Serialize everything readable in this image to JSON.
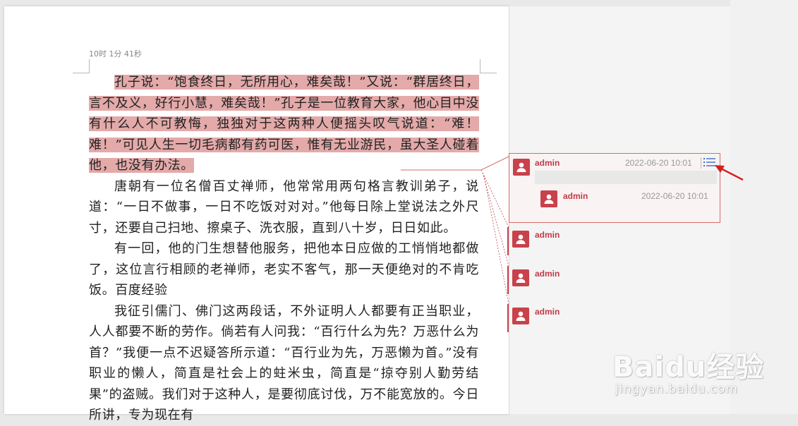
{
  "document": {
    "header_note": "10时 1分 41秒",
    "paragraphs": [
      "孔子说：“饱食终日，无所用心，难矣哉！”又说：“群居终日，言不及义，好行小慧，难矣哉！”孔子是一位教育大家，他心目中没有什么人不可教悔，独独对于这两种人便摇头叹气说道：“难！难！”可见人生一切毛病都有药可医，惟有无业游民，虽大圣人碰着他，也没有办法。",
      "唐朝有一位名僧百丈禅师，他常常用两句格言教训弟子，说道：“一日不做事，一日不吃饭对对对。”他每日除上堂说法之外尺寸，还要自己扫地、擦桌子、洗衣服，直到八十岁，日日如此。",
      "有一回，他的门生想替他服务，把他本日应做的工悄悄地都做了，这位言行相顾的老禅师，老实不客气，那一天便绝对的不肯吃饭。百度经验",
      "我征引儒门、佛门这两段话，不外证明人人都要有正当职业，人人都要不断的劳作。倘若有人问我：“百行什么为先？万恶什么为首？”我便一点不迟疑答所示道：“百行业为先，万恶懒为首。”没有职业的懒人，简直是社会上的蛀米虫，简直是“掠夺别人勤劳结果”的盗贼。我们对于这种人，是要彻底讨伐，万不能宽放的。今日所讲，专为现在有"
    ]
  },
  "comments": {
    "active": {
      "author": "admin",
      "time": "2022-06-20 10:01",
      "menu_icon": "list-menu-icon",
      "reply": {
        "author": "admin",
        "time": "2022-06-20 10:01"
      }
    },
    "collapsed": [
      {
        "author": "admin"
      },
      {
        "author": "admin"
      },
      {
        "author": "admin"
      }
    ]
  },
  "watermark": {
    "main": "Baidu经验",
    "sub": "jingyan.baidu.com"
  },
  "colors": {
    "highlight": "#e4a9a9",
    "accent": "#c9414a",
    "author_text": "#c23a47",
    "annotation_arrow": "#d42020"
  }
}
